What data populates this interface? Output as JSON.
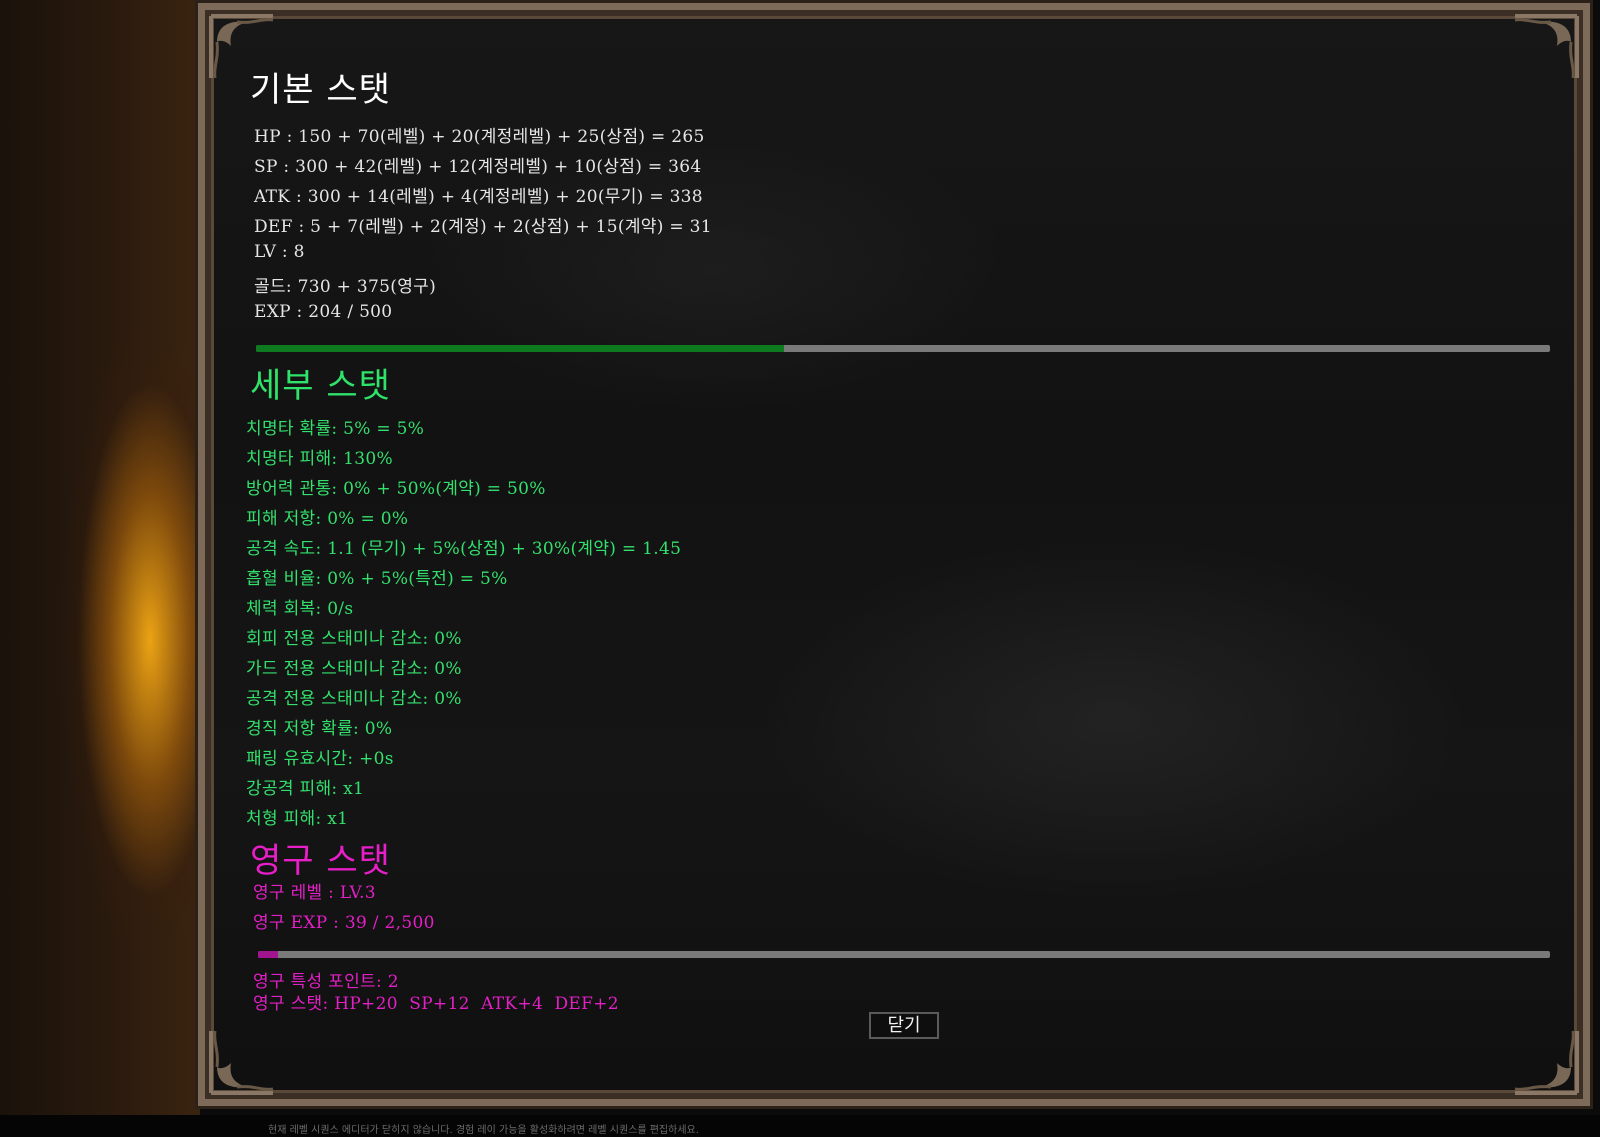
{
  "basic": {
    "title": "기본 스탯",
    "lines": [
      "HP : 150 + 70(레벨) + 20(계정레벨) + 25(상점) = 265",
      "SP : 300 + 42(레벨) + 12(계정레벨) + 10(상점) = 364",
      "ATK : 300 + 14(레벨) + 4(계정레벨) + 20(무기) = 338",
      "DEF : 5 + 7(레벨) + 2(계정) + 2(상점) + 15(계약) = 31",
      "LV : 8",
      "골드: 730 + 375(영구)",
      "EXP : 204 / 500"
    ],
    "exp_progress": 0.408,
    "exp_color": "#0d7a1f"
  },
  "detail": {
    "title": "세부 스탯",
    "lines": [
      "치명타 확률: 5% = 5%",
      "치명타 피해: 130%",
      "방어력 관통: 0% + 50%(계약) = 50%",
      "피해 저항: 0% = 0%",
      "공격 속도: 1.1 (무기) + 5%(상점) + 30%(계약) = 1.45",
      "흡혈 비율: 0% + 5%(특전) = 5%",
      "체력 회복: 0/s",
      "회피 전용 스태미나 감소: 0%",
      "가드 전용 스태미나 감소: 0%",
      "공격 전용 스태미나 감소: 0%",
      "경직 저항 확률: 0%",
      "패링 유효시간: +0s",
      "강공격 피해: x1",
      "처형 피해: x1"
    ],
    "color": "#33e06d"
  },
  "permanent": {
    "title": "영구 스탯",
    "level_line": "영구 레벨 : LV.3",
    "exp_line": "영구 EXP : 39 / 2,500",
    "exp_progress": 0.0156,
    "trait_points_line": "영구 특성 포인트: 2",
    "stats_line": "영구 스탯: HP+20  SP+12  ATK+4  DEF+2",
    "color": "#e31fc6"
  },
  "close_button": {
    "label": "닫기"
  },
  "footer": {
    "note": "현재 레벨 시퀀스 에디터가 닫히지 않습니다. 경험 레이 가능을 활성화하려면 레벨 시퀀스를 편집하세요."
  }
}
